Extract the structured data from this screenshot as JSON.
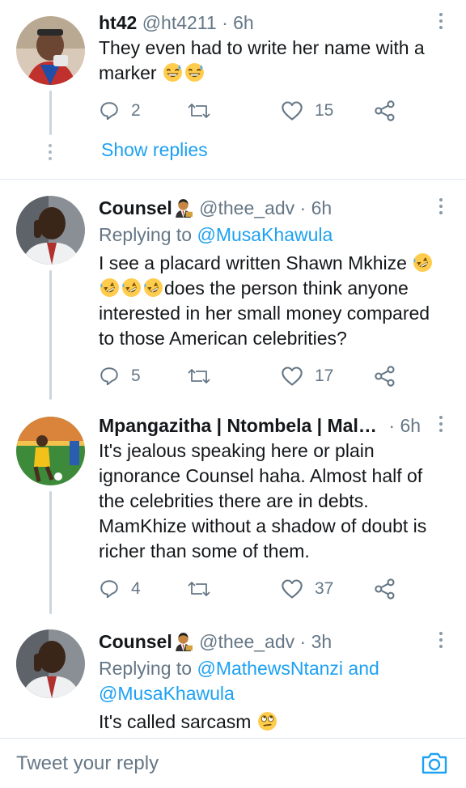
{
  "tweets": [
    {
      "display_name": "ht42",
      "handle": "@ht4211",
      "time": "· 6h",
      "replying_prefix": "",
      "replying_to": "",
      "text_parts": [
        "They even had to write her name with a marker "
      ],
      "emoji": [
        "grin-sweat-emoji",
        "grin-sweat-emoji"
      ],
      "replies": "2",
      "likes": "15",
      "show_replies": "Show replies"
    },
    {
      "display_name": "Counsel",
      "handle": "@thee_adv",
      "time": "· 6h",
      "replying_prefix": "Replying to ",
      "replying_to": "@MusaKhawula",
      "text_a": "I see a placard written Shawn Mkhize ",
      "text_b": "does the person think anyone interested in her small money compared to those American celebrities?",
      "replies": "5",
      "likes": "17"
    },
    {
      "display_name": "Mpangazitha | Ntombela | Mala...",
      "handle": "",
      "time": "· 6h",
      "text": "It's jealous speaking here or plain ignorance Counsel haha. Almost half of the celebrities there are in debts. MamKhize without a shadow of doubt is richer than some of them.",
      "replies": "4",
      "likes": "37"
    },
    {
      "display_name": "Counsel",
      "handle": "@thee_adv",
      "time": "· 3h",
      "replying_prefix": "Replying to ",
      "replying_to": "@MathewsNtanzi and @MusaKhawula",
      "replying_line1": "@MathewsNtanzi and",
      "replying_line2": "@MusaKhawula",
      "text": "It's called sarcasm "
    }
  ],
  "reply_bar": {
    "placeholder": "Tweet your reply"
  },
  "colors": {
    "accent": "#1da1f2",
    "muted": "#657786",
    "text": "#14171a",
    "divider": "#e1e8ed"
  }
}
